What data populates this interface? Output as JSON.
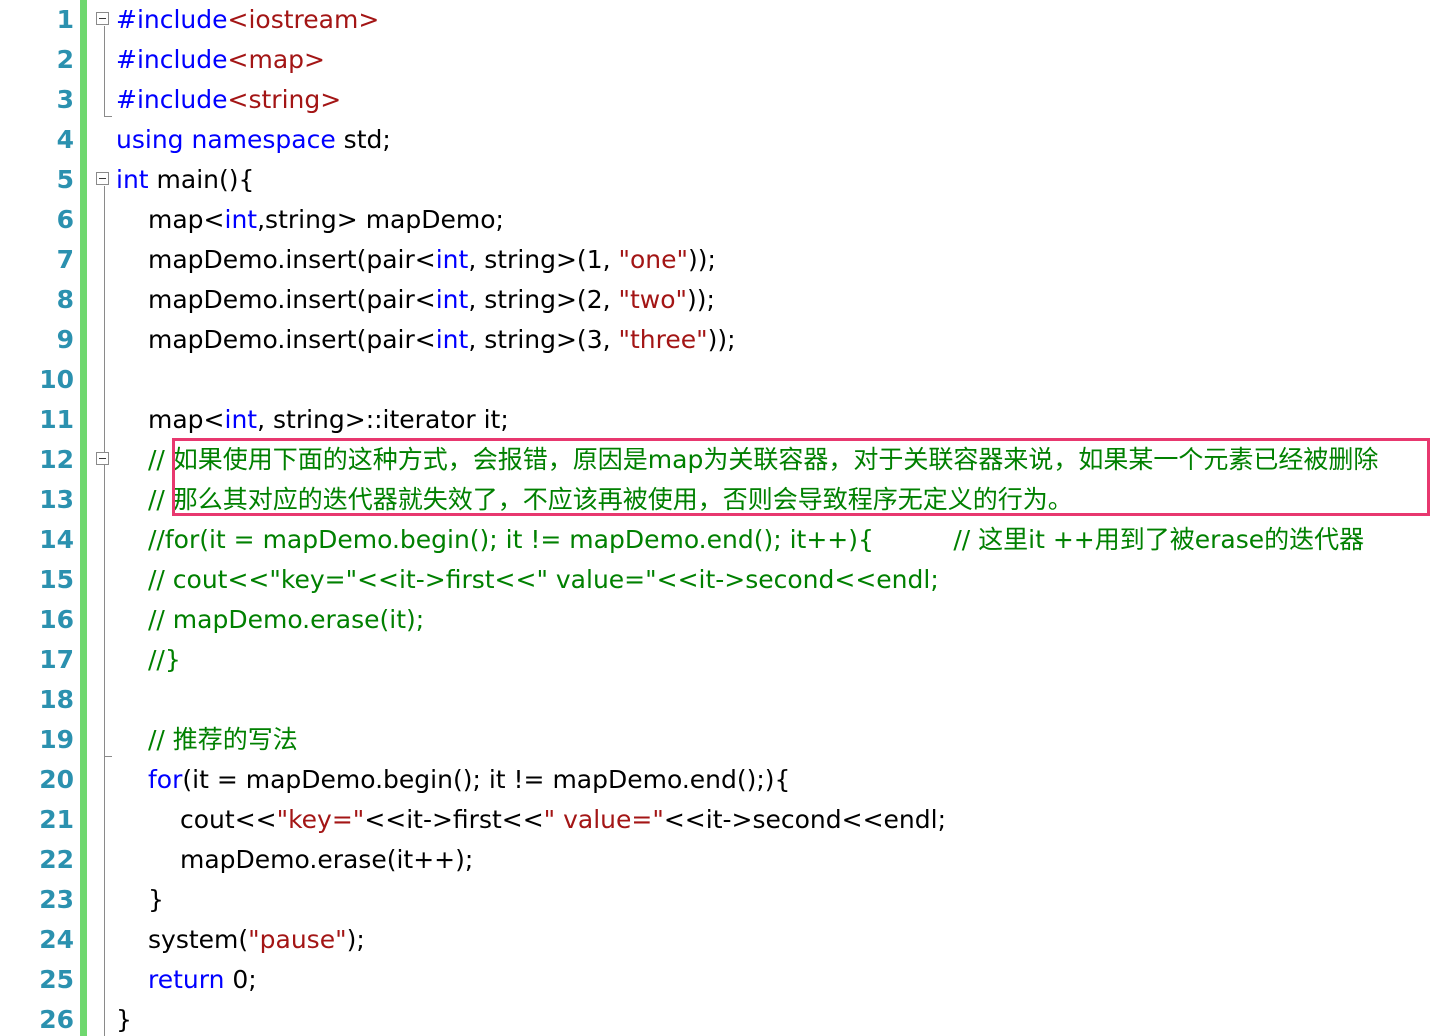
{
  "editor": {
    "colors": {
      "keyword": "#0000ff",
      "string": "#a31515",
      "comment": "#008000",
      "line_number": "#2b91af",
      "change_bar": "#6fd86f",
      "highlight_box": "#e8386f"
    },
    "lines": [
      {
        "n": "1",
        "indent": 0,
        "tokens": [
          {
            "t": "#include",
            "c": "pp"
          },
          {
            "t": "<iostream>",
            "c": "str"
          }
        ]
      },
      {
        "n": "2",
        "indent": 0,
        "tokens": [
          {
            "t": "#include",
            "c": "pp"
          },
          {
            "t": "<map>",
            "c": "str"
          }
        ]
      },
      {
        "n": "3",
        "indent": 0,
        "tokens": [
          {
            "t": "#include",
            "c": "pp"
          },
          {
            "t": "<string>",
            "c": "str"
          }
        ]
      },
      {
        "n": "4",
        "indent": 0,
        "tokens": [
          {
            "t": "using",
            "c": "kw"
          },
          {
            "t": " ",
            "c": ""
          },
          {
            "t": "namespace",
            "c": "kw"
          },
          {
            "t": " std;",
            "c": ""
          }
        ]
      },
      {
        "n": "5",
        "indent": 0,
        "tokens": [
          {
            "t": "int",
            "c": "kw"
          },
          {
            "t": " main(){",
            "c": ""
          }
        ]
      },
      {
        "n": "6",
        "indent": 1,
        "tokens": [
          {
            "t": "map<",
            "c": ""
          },
          {
            "t": "int",
            "c": "kw"
          },
          {
            "t": ",string> mapDemo;",
            "c": ""
          }
        ]
      },
      {
        "n": "7",
        "indent": 1,
        "tokens": [
          {
            "t": "mapDemo.insert(pair<",
            "c": ""
          },
          {
            "t": "int",
            "c": "kw"
          },
          {
            "t": ", string>(1, ",
            "c": ""
          },
          {
            "t": "\"one\"",
            "c": "str"
          },
          {
            "t": "));",
            "c": ""
          }
        ]
      },
      {
        "n": "8",
        "indent": 1,
        "tokens": [
          {
            "t": "mapDemo.insert(pair<",
            "c": ""
          },
          {
            "t": "int",
            "c": "kw"
          },
          {
            "t": ", string>(2, ",
            "c": ""
          },
          {
            "t": "\"two\"",
            "c": "str"
          },
          {
            "t": "));",
            "c": ""
          }
        ]
      },
      {
        "n": "9",
        "indent": 1,
        "tokens": [
          {
            "t": "mapDemo.insert(pair<",
            "c": ""
          },
          {
            "t": "int",
            "c": "kw"
          },
          {
            "t": ", string>(3, ",
            "c": ""
          },
          {
            "t": "\"three\"",
            "c": "str"
          },
          {
            "t": "));",
            "c": ""
          }
        ]
      },
      {
        "n": "10",
        "indent": 1,
        "tokens": []
      },
      {
        "n": "11",
        "indent": 1,
        "tokens": [
          {
            "t": "map<",
            "c": ""
          },
          {
            "t": "int",
            "c": "kw"
          },
          {
            "t": ", string>::iterator it;",
            "c": ""
          }
        ]
      },
      {
        "n": "12",
        "indent": 1,
        "tokens": [
          {
            "t": "// 如果使用下面的这种方式，会报错，原因是map为关联容器，对于关联容器来说，如果某一个元素已经被删除",
            "c": "cmt"
          }
        ]
      },
      {
        "n": "13",
        "indent": 1,
        "tokens": [
          {
            "t": "// 那么其对应的迭代器就失效了，不应该再被使用，否则会导致程序无定义的行为。",
            "c": "cmt"
          }
        ]
      },
      {
        "n": "14",
        "indent": 1,
        "tokens": [
          {
            "t": "//for(it = mapDemo.begin(); it != mapDemo.end(); it++){          // 这里it ++用到了被erase的迭代器",
            "c": "cmt"
          }
        ]
      },
      {
        "n": "15",
        "indent": 1,
        "tokens": [
          {
            "t": "// cout<<\"key=\"<<it->first<<\" value=\"<<it->second<<endl;",
            "c": "cmt"
          }
        ]
      },
      {
        "n": "16",
        "indent": 1,
        "tokens": [
          {
            "t": "// mapDemo.erase(it);",
            "c": "cmt"
          }
        ]
      },
      {
        "n": "17",
        "indent": 1,
        "tokens": [
          {
            "t": "//}",
            "c": "cmt"
          }
        ]
      },
      {
        "n": "18",
        "indent": 1,
        "tokens": []
      },
      {
        "n": "19",
        "indent": 1,
        "tokens": [
          {
            "t": "// 推荐的写法",
            "c": "cmt"
          }
        ]
      },
      {
        "n": "20",
        "indent": 1,
        "tokens": [
          {
            "t": "for",
            "c": "kw"
          },
          {
            "t": "(it = mapDemo.begin(); it != mapDemo.end();){",
            "c": ""
          }
        ]
      },
      {
        "n": "21",
        "indent": 2,
        "tokens": [
          {
            "t": "cout<<",
            "c": ""
          },
          {
            "t": "\"key=\"",
            "c": "str"
          },
          {
            "t": "<<it->first<<",
            "c": ""
          },
          {
            "t": "\" value=\"",
            "c": "str"
          },
          {
            "t": "<<it->second<<endl;",
            "c": ""
          }
        ]
      },
      {
        "n": "22",
        "indent": 2,
        "tokens": [
          {
            "t": "mapDemo.erase(it++);",
            "c": ""
          }
        ]
      },
      {
        "n": "23",
        "indent": 1,
        "tokens": [
          {
            "t": "}",
            "c": ""
          }
        ]
      },
      {
        "n": "24",
        "indent": 1,
        "tokens": [
          {
            "t": "system(",
            "c": ""
          },
          {
            "t": "\"pause\"",
            "c": "str"
          },
          {
            "t": ");",
            "c": ""
          }
        ]
      },
      {
        "n": "25",
        "indent": 1,
        "tokens": [
          {
            "t": "return",
            "c": "kw"
          },
          {
            "t": " 0;",
            "c": ""
          }
        ]
      },
      {
        "n": "26",
        "indent": 0,
        "tokens": [
          {
            "t": "}",
            "c": ""
          }
        ]
      }
    ]
  }
}
